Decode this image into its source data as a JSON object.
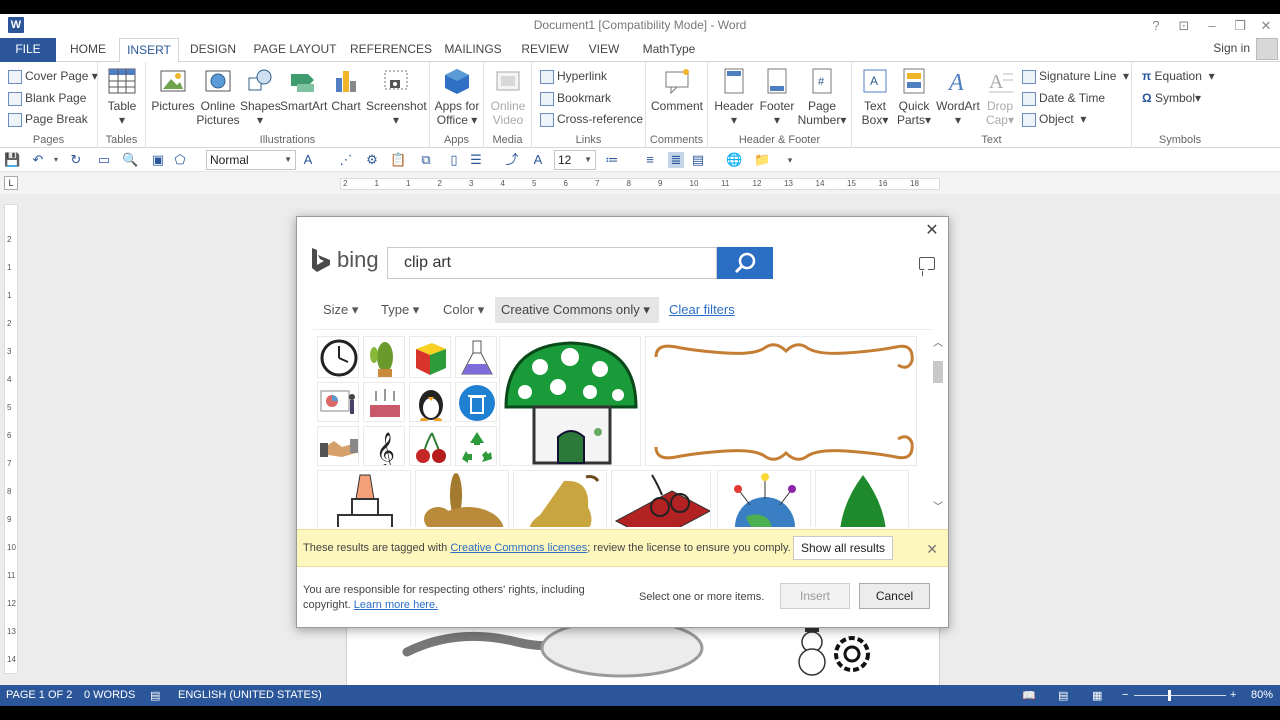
{
  "title_bar": {
    "app_icon_letter": "W",
    "document_title": "Document1 [Compatibility Mode] - Word",
    "help": "?",
    "ribbon_display": "⊡",
    "minimize": "–",
    "restore": "❐",
    "close": "✕"
  },
  "tabs": [
    {
      "label": "FILE"
    },
    {
      "label": "HOME"
    },
    {
      "label": "INSERT"
    },
    {
      "label": "DESIGN"
    },
    {
      "label": "PAGE LAYOUT"
    },
    {
      "label": "REFERENCES"
    },
    {
      "label": "MAILINGS"
    },
    {
      "label": "REVIEW"
    },
    {
      "label": "VIEW"
    },
    {
      "label": "MathType"
    }
  ],
  "sign_in": "Sign in",
  "ribbon": {
    "pages": {
      "label": "Pages",
      "cover_page": "Cover Page",
      "blank_page": "Blank Page",
      "page_break": "Page Break"
    },
    "tables": {
      "label": "Tables",
      "table": "Table"
    },
    "illustrations": {
      "label": "Illustrations",
      "pictures": "Pictures",
      "online_pictures_1": "Online",
      "online_pictures_2": "Pictures",
      "shapes": "Shapes",
      "smartart": "SmartArt",
      "chart": "Chart",
      "screenshot": "Screenshot"
    },
    "apps": {
      "label": "Apps",
      "apps_for_office_1": "Apps for",
      "apps_for_office_2": "Office"
    },
    "media": {
      "label": "Media",
      "online_video_1": "Online",
      "online_video_2": "Video"
    },
    "links": {
      "label": "Links",
      "hyperlink": "Hyperlink",
      "bookmark": "Bookmark",
      "cross_reference": "Cross-reference"
    },
    "comments": {
      "label": "Comments",
      "comment": "Comment"
    },
    "header_footer": {
      "label": "Header & Footer",
      "header": "Header",
      "footer": "Footer",
      "page_number_1": "Page",
      "page_number_2": "Number"
    },
    "text": {
      "label": "Text",
      "text_box_1": "Text",
      "text_box_2": "Box",
      "quick_parts_1": "Quick",
      "quick_parts_2": "Parts",
      "wordart": "WordArt",
      "drop_cap_1": "Drop",
      "drop_cap_2": "Cap",
      "signature_line": "Signature Line",
      "date_time": "Date & Time",
      "object": "Object"
    },
    "symbols": {
      "label": "Symbols",
      "equation": "Equation",
      "symbol": "Symbol"
    }
  },
  "format_bar": {
    "style_value": "Normal",
    "font_size_value": "12"
  },
  "ruler": {
    "h_numbers": [
      "2",
      "1",
      "1",
      "2",
      "3",
      "4",
      "5",
      "6",
      "7",
      "8",
      "9",
      "10",
      "11",
      "12",
      "13",
      "14",
      "15",
      "16",
      "18"
    ],
    "v_numbers": [
      "2",
      "1",
      "1",
      "2",
      "3",
      "4",
      "5",
      "6",
      "7",
      "8",
      "9",
      "10",
      "11",
      "12",
      "13",
      "14"
    ]
  },
  "dialog": {
    "brand": "bing",
    "search_value": "clip art",
    "filters": {
      "size": "Size",
      "type": "Type",
      "color": "Color",
      "license": "Creative Commons only",
      "clear": "Clear filters"
    },
    "notice": {
      "prefix": "These results are tagged with ",
      "link": "Creative Commons licenses",
      "suffix": "; review the license to ensure you comply.",
      "show_all": "Show all results"
    },
    "footer_text": "You are responsible for respecting others' rights, including copyright.",
    "learn_more": "Learn more here.",
    "status": "Select one or more items.",
    "insert": "Insert",
    "cancel": "Cancel"
  },
  "status_bar": {
    "page": "PAGE 1 OF 2",
    "words": "0 WORDS",
    "language": "ENGLISH (UNITED STATES)",
    "zoom": "80%"
  },
  "colors": {
    "word_blue": "#2b579a",
    "bing_search_blue": "#2b6fc4",
    "notice_yellow": "#fdf6bd"
  }
}
